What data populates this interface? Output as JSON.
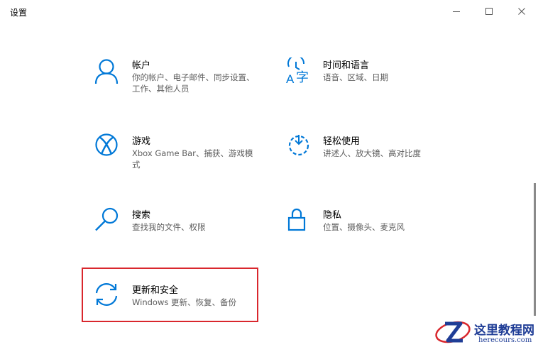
{
  "window": {
    "title": "设置"
  },
  "colors": {
    "accent": "#0078d7",
    "highlight": "#d9272d",
    "description": "#5d5d5d"
  },
  "tiles": [
    {
      "icon": "person-icon",
      "title": "帐户",
      "desc": "你的帐户、电子邮件、同步设置、工作、其他人员"
    },
    {
      "icon": "time-language-icon",
      "title": "时间和语言",
      "desc": "语音、区域、日期"
    },
    {
      "icon": "xbox-icon",
      "title": "游戏",
      "desc": "Xbox Game Bar、捕获、游戏模式"
    },
    {
      "icon": "ease-of-access-icon",
      "title": "轻松使用",
      "desc": "讲述人、放大镜、高对比度"
    },
    {
      "icon": "search-icon",
      "title": "搜索",
      "desc": "查找我的文件、权限"
    },
    {
      "icon": "lock-icon",
      "title": "隐私",
      "desc": "位置、摄像头、麦克风"
    },
    {
      "icon": "sync-icon",
      "title": "更新和安全",
      "desc": "Windows 更新、恢复、备份"
    }
  ],
  "watermark": {
    "text": "这里教程网",
    "url": "herecours.com"
  }
}
